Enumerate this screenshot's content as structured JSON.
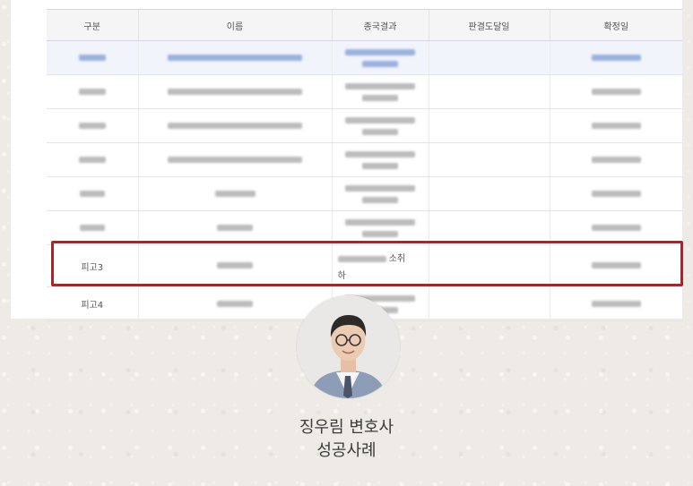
{
  "table": {
    "headers": [
      "구분",
      "이름",
      "종국결과",
      "판결도달일",
      "확정일"
    ],
    "visible_labels": {
      "defendant3": "피고3",
      "defendant4": "피고4",
      "result_suffix_1": "소취",
      "result_suffix_2": "하"
    }
  },
  "caption": {
    "line1": "징우림 변호사",
    "line2": "성공사례"
  },
  "colors": {
    "highlight": "#d0141b",
    "blurred_link": "#9bb1df",
    "blurred_text": "#bcbcbc"
  },
  "icons": {
    "profile": "lawyer-portrait"
  }
}
